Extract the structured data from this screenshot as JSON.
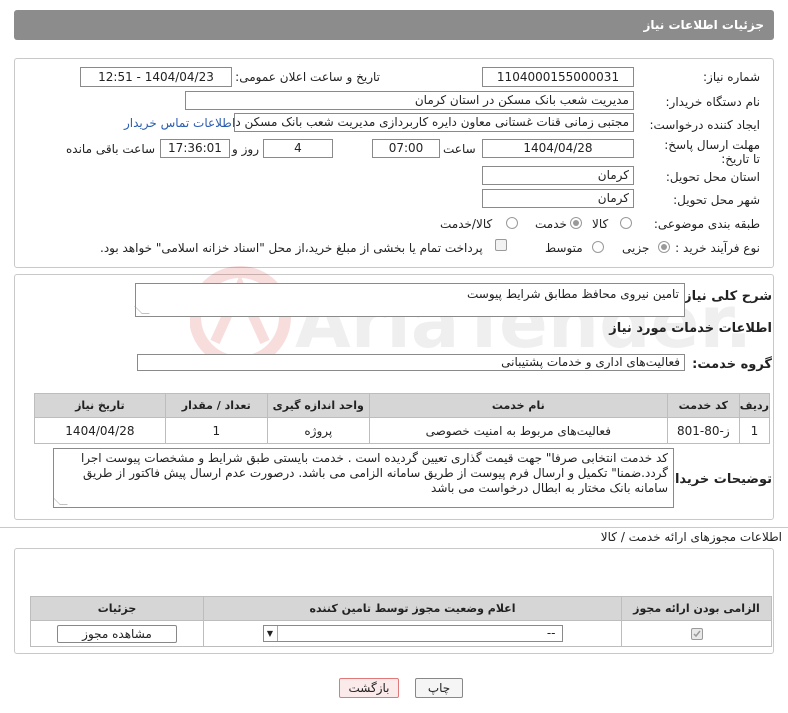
{
  "header": {
    "title": "جزئیات اطلاعات نیاز"
  },
  "form": {
    "need_number_label": "شماره نیاز:",
    "need_number": "1104000155000031",
    "announce_label": "تاریخ و ساعت اعلان عمومی:",
    "announce_value": "1404/04/23 - 12:51",
    "buyer_org_label": "نام دستگاه خریدار:",
    "buyer_org": "مدیریت شعب بانک مسکن در استان کرمان",
    "creator_label": "ایجاد کننده درخواست:",
    "creator": "مجتبی زمانی قنات غستانی معاون دایره کاربردازی مدیریت شعب بانک مسکن د",
    "contact_link": "اطلاعات تماس خریدار",
    "deadline_label": "مهلت ارسال پاسخ: تا تاریخ:",
    "deadline_date": "1404/04/28",
    "time_label": "ساعت",
    "deadline_time": "07:00",
    "days_value": "4",
    "days_label": "روز و",
    "remaining_time": "17:36:01",
    "remaining_label": "ساعت باقی مانده",
    "province_label": "استان محل تحویل:",
    "province": "کرمان",
    "city_label": "شهر محل تحویل:",
    "city": "کرمان",
    "category_label": "طبقه بندی موضوعی:",
    "category_options": [
      "کالا",
      "خدمت",
      "کالا/خدمت"
    ],
    "category_selected": "خدمت",
    "process_label": "نوع فرآیند خرید :",
    "process_options": [
      "جزیی",
      "متوسط"
    ],
    "process_selected": "جزیی",
    "payment_note": "پرداخت تمام یا بخشی از مبلغ خرید،از محل \"اسناد خزانه اسلامی\" خواهد بود."
  },
  "details": {
    "summary_label": "شرح کلی نیاز:",
    "summary": "تامین نیروی محافظ مطابق شرایط پیوست",
    "services_title": "اطلاعات خدمات مورد نیاز",
    "group_label": "گروه خدمت:",
    "group_value": "فعالیت‌های اداری و خدمات پشتیبانی",
    "table_headers": [
      "ردیف",
      "کد خدمت",
      "نام خدمت",
      "واحد اندازه گیری",
      "تعداد / مقدار",
      "تاریخ نیاز"
    ],
    "rows": [
      [
        "1",
        "ز-80-801",
        "فعالیت‌های مربوط به امنیت خصوصی",
        "پروژه",
        "1",
        "1404/04/28"
      ]
    ],
    "buyer_notes_label": "توضیحات خریدار:",
    "buyer_notes": "کد خدمت انتخابی صرفا\" جهت قیمت گذاری تعیین گردیده است . خدمت بایستی طبق شرایط و مشخصات پیوست اجرا گردد.ضمنا\" تکمیل و ارسال فرم پیوست از طریق سامانه الزامی می باشد. درصورت عدم ارسال پیش فاکتور از طریق سامانه بانک مختار به ابطال درخواست می باشد"
  },
  "permits": {
    "title": "اطلاعات مجوزهای ارائه خدمت / کالا",
    "headers": [
      "الزامی بودن ارائه مجوز",
      "اعلام وضعیت مجوز توسط تامین کننده",
      "جزئیات"
    ],
    "select_value": "--",
    "view_button": "مشاهده مجوز"
  },
  "actions": {
    "print": "چاپ",
    "back": "بازگشت"
  },
  "watermark": "AriaTender.neT",
  "colors": {
    "header_bg": "#8c8c8c",
    "table_header_bg": "#d6d6d6",
    "link": "#2a5db0",
    "back_btn_border": "#e07a7a"
  }
}
